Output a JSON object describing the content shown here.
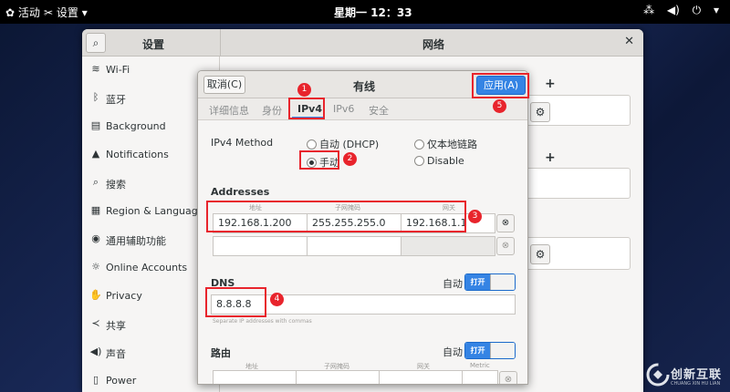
{
  "topbar": {
    "activities": "活动",
    "app_menu": "设置",
    "clock": "星期一 12：33"
  },
  "settings": {
    "sidebar_title": "设置",
    "main_title": "网络",
    "sidebar_items": [
      {
        "label": "Wi-Fi",
        "icon": "wifi-icon"
      },
      {
        "label": "蓝牙",
        "icon": "bluetooth-icon"
      },
      {
        "label": "Background",
        "icon": "background-icon"
      },
      {
        "label": "Notifications",
        "icon": "bell-icon"
      },
      {
        "label": "搜索",
        "icon": "search-icon"
      },
      {
        "label": "Region & Language",
        "icon": "flag-icon"
      },
      {
        "label": "通用辅助功能",
        "icon": "accessibility-icon"
      },
      {
        "label": "Online Accounts",
        "icon": "online-accounts-icon"
      },
      {
        "label": "Privacy",
        "icon": "hand-icon"
      },
      {
        "label": "共享",
        "icon": "share-icon"
      },
      {
        "label": "声音",
        "icon": "speaker-icon"
      },
      {
        "label": "Power",
        "icon": "power-icon"
      }
    ]
  },
  "dialog": {
    "title": "有线",
    "cancel": "取消(C)",
    "apply": "应用(A)",
    "tabs": [
      "详细信息",
      "身份",
      "IPv4",
      "IPv6",
      "安全"
    ],
    "active_tab": "IPv4",
    "ipv4_method_label": "IPv4 Method",
    "methods": {
      "auto": "自动 (DHCP)",
      "link_local": "仅本地链路",
      "manual": "手动",
      "disable": "Disable"
    },
    "selected_method": "手动",
    "addresses_label": "Addresses",
    "addr_headers": [
      "地址",
      "子网掩码",
      "网关"
    ],
    "addr_row": {
      "address": "192.168.1.200",
      "netmask": "255.255.255.0",
      "gateway": "192.168.1.1"
    },
    "dns_label": "DNS",
    "dns_auto_label": "自动",
    "dns_toggle": "打开",
    "dns_value": "8.8.8.8",
    "dns_hint": "Separate IP addresses with commas",
    "routes_label": "路由",
    "routes_auto_label": "自动",
    "routes_toggle": "打开",
    "route_headers": [
      "地址",
      "子网掩码",
      "网关",
      "Metric"
    ]
  },
  "annotations": [
    "1",
    "2",
    "3",
    "4",
    "5"
  ],
  "watermark": {
    "text": "创新互联",
    "sub": "CHUANG XIN HU LIAN"
  },
  "colors": {
    "accent": "#3584e4",
    "annotation": "#e8242c"
  }
}
